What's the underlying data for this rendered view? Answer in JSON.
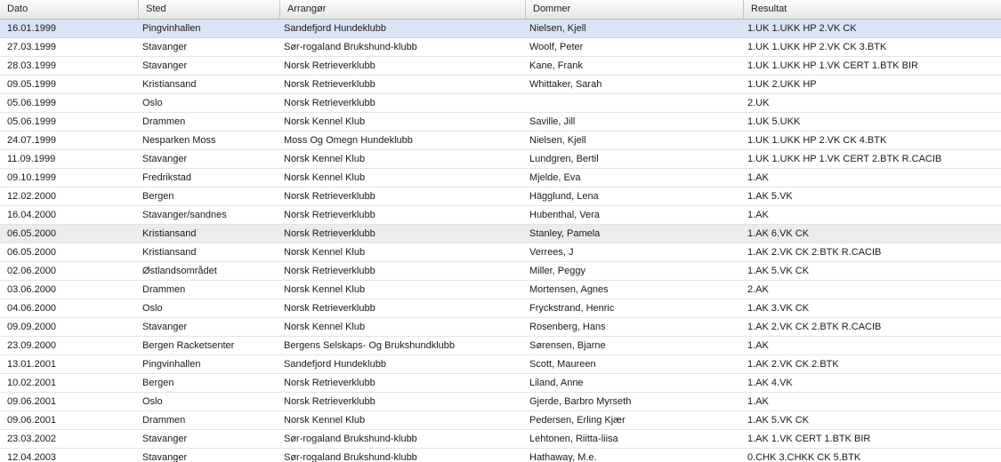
{
  "table": {
    "columns": [
      "Dato",
      "Sted",
      "Arrangør",
      "Dommer",
      "Resultat"
    ],
    "rows": [
      [
        "16.01.1999",
        "Pingvinhallen",
        "Sandefjord Hundeklubb",
        "Nielsen, Kjell",
        "1.UK 1.UKK HP 2.VK CK"
      ],
      [
        "27.03.1999",
        "Stavanger",
        "Sør-rogaland Brukshund-klubb",
        "Woolf, Peter",
        "1.UK 1.UKK HP 2.VK CK 3.BTK"
      ],
      [
        "28.03.1999",
        "Stavanger",
        "Norsk Retrieverklubb",
        "Kane, Frank",
        "1.UK 1.UKK HP 1.VK CERT 1.BTK BIR"
      ],
      [
        "09.05.1999",
        "Kristiansand",
        "Norsk Retrieverklubb",
        "Whittaker, Sarah",
        "1.UK 2.UKK HP"
      ],
      [
        "05.06.1999",
        "Oslo",
        "Norsk Retrieverklubb",
        "",
        "2.UK"
      ],
      [
        "05.06.1999",
        "Drammen",
        "Norsk Kennel Klub",
        "Saville, Jill",
        "1.UK 5.UKK"
      ],
      [
        "24.07.1999",
        "Nesparken Moss",
        "Moss Og Omegn Hundeklubb",
        "Nielsen, Kjell",
        "1.UK 1.UKK HP 2.VK CK 4.BTK"
      ],
      [
        "11.09.1999",
        "Stavanger",
        "Norsk Kennel Klub",
        "Lundgren, Bertil",
        "1.UK 1.UKK HP 1.VK CERT 2.BTK R.CACIB"
      ],
      [
        "09.10.1999",
        "Fredrikstad",
        "Norsk Kennel Klub",
        "Mjelde, Eva",
        "1.AK"
      ],
      [
        "12.02.2000",
        "Bergen",
        "Norsk Retrieverklubb",
        "Hägglund, Lena",
        "1.AK 5.VK"
      ],
      [
        "16.04.2000",
        "Stavanger/sandnes",
        "Norsk Retrieverklubb",
        "Hubenthal, Vera",
        "1.AK"
      ],
      [
        "06.05.2000",
        "Kristiansand",
        "Norsk Retrieverklubb",
        "Stanley, Pamela",
        "1.AK 6.VK CK"
      ],
      [
        "06.05.2000",
        "Kristiansand",
        "Norsk Kennel Klub",
        "Verrees, J",
        "1.AK 2.VK CK 2.BTK R.CACIB"
      ],
      [
        "02.06.2000",
        "Østlandsområdet",
        "Norsk Retrieverklubb",
        "Miller, Peggy",
        "1.AK 5.VK CK"
      ],
      [
        "03.06.2000",
        "Drammen",
        "Norsk Kennel Klub",
        "Mortensen, Agnes",
        "2.AK"
      ],
      [
        "04.06.2000",
        "Oslo",
        "Norsk Retrieverklubb",
        "Fryckstrand, Henric",
        "1.AK 3.VK CK"
      ],
      [
        "09.09.2000",
        "Stavanger",
        "Norsk Kennel Klub",
        "Rosenberg, Hans",
        "1.AK 2.VK CK 2.BTK R.CACIB"
      ],
      [
        "23.09.2000",
        "Bergen Racketsenter",
        "Bergens Selskaps- Og Brukshundklubb",
        "Sørensen, Bjarne",
        "1.AK"
      ],
      [
        "13.01.2001",
        "Pingvinhallen",
        "Sandefjord Hundeklubb",
        "Scott, Maureen",
        "1.AK 2.VK CK 2.BTK"
      ],
      [
        "10.02.2001",
        "Bergen",
        "Norsk Retrieverklubb",
        "Liland, Anne",
        "1.AK 4.VK"
      ],
      [
        "09.06.2001",
        "Oslo",
        "Norsk Retrieverklubb",
        "Gjerde, Barbro Myrseth",
        "1.AK"
      ],
      [
        "09.06.2001",
        "Drammen",
        "Norsk Kennel Klub",
        "Pedersen, Erling Kjær",
        "1.AK 5.VK CK"
      ],
      [
        "23.03.2002",
        "Stavanger",
        "Sør-rogaland Brukshund-klubb",
        "Lehtonen, Riitta-liisa",
        "1.AK 1.VK CERT 1.BTK BIR"
      ],
      [
        "12.04.2003",
        "Stavanger",
        "Sør-rogaland Brukshund-klubb",
        "Hathaway, M.e.",
        "0.CHK 3.CHKK CK 5.BTK"
      ]
    ]
  },
  "colors": {
    "selected_row": "#dae4f5",
    "hover_row": "#ececec",
    "row_divider": "#e4e4e4"
  }
}
